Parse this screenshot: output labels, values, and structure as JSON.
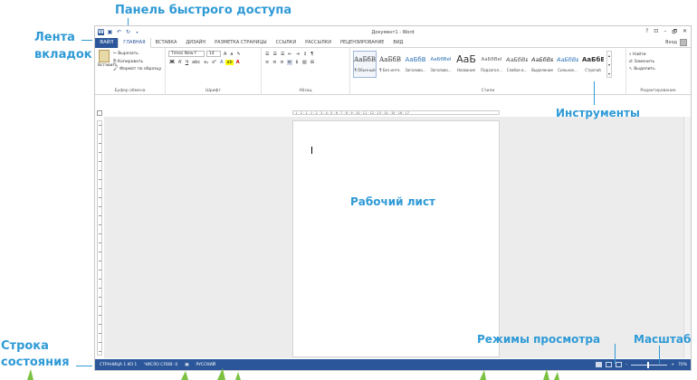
{
  "labels": {
    "quick_access": "Панель быстрого доступа",
    "ribbon_tabs_line1": "Лента",
    "ribbon_tabs_line2": "вкладок",
    "tools": "Инструменты",
    "worksheet": "Рабочий лист",
    "status_bar_line1": "Строка",
    "status_bar_line2": "состояния",
    "view_modes": "Режимы просмотра",
    "zoom": "Масштаб"
  },
  "window": {
    "title": "Документ1 - Word",
    "controls": [
      "?",
      "⊡",
      "–",
      "🗗",
      "✕"
    ],
    "user": "Вход"
  },
  "tabs": [
    {
      "label": "ФАЙЛ"
    },
    {
      "label": "ГЛАВНАЯ"
    },
    {
      "label": "ВСТАВКА"
    },
    {
      "label": "ДИЗАЙН"
    },
    {
      "label": "РАЗМЕТКА СТРАНИЦЫ"
    },
    {
      "label": "ССЫЛКИ"
    },
    {
      "label": "РАССЫЛКИ"
    },
    {
      "label": "РЕЦЕНЗИРОВАНИЕ"
    },
    {
      "label": "ВИД"
    }
  ],
  "ribbon": {
    "clipboard": {
      "name": "Буфер обмена",
      "paste": "Вставить",
      "cut": "Вырезать",
      "copy": "Копировать",
      "format_painter": "Формат по образцу"
    },
    "font": {
      "name": "Шрифт",
      "family": "Times New F",
      "size": "14"
    },
    "paragraph": {
      "name": "Абзац"
    },
    "styles": {
      "name": "Стили",
      "items": [
        {
          "sample": "АаБбВв",
          "name": "¶ Обычный"
        },
        {
          "sample": "АаБбВв",
          "name": "¶ Без инте..."
        },
        {
          "sample": "АаБбВ",
          "name": "Заголово..."
        },
        {
          "sample": "АаБбВеI",
          "name": "Заголово..."
        },
        {
          "sample": "АаБ",
          "name": "Название"
        },
        {
          "sample": "АаБбВеI",
          "name": "Подзагол..."
        },
        {
          "sample": "АаБбВв",
          "name": "Слабое в..."
        },
        {
          "sample": "АаБбВв",
          "name": "Выделение"
        },
        {
          "sample": "АаБбВв",
          "name": "Сильное..."
        },
        {
          "sample": "АаБбВ",
          "name": "Строгий"
        }
      ]
    },
    "editing": {
      "name": "Редактирование",
      "find": "Найти",
      "replace": "Заменить",
      "select": "Выделить"
    }
  },
  "ruler_text": "· 1 · 2 · 1 · 1 · 2 · 3 · 4 · 5 · 6 · 7 · 8 · 9 · 10 · 11 · 12 · 13 · 14 · 15 · 16 · 17",
  "status": {
    "page": "СТРАНИЦА 1 ИЗ 1",
    "words": "ЧИСЛО СЛОВ: 0",
    "language": "РУССКИЙ",
    "zoom": "70%"
  }
}
